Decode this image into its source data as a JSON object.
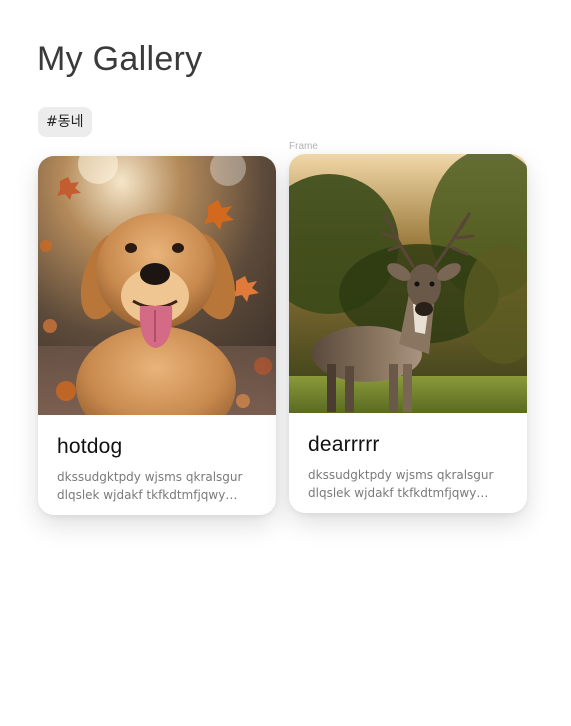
{
  "page": {
    "title": "My Gallery"
  },
  "tags": [
    {
      "label": "#동네"
    }
  ],
  "frame_label": "Frame",
  "cards": [
    {
      "title": "hotdog",
      "description": "dkssudgktpdy wjsms qkralsgur dlqslek wjdakf tkfkdtmfjqwy…",
      "image_icon": "golden-retriever-photo"
    },
    {
      "title": "dearrrrr",
      "description": "dkssudgktpdy wjsms qkralsgur dlqslek wjdakf tkfkdtmfjqwy…",
      "image_icon": "deer-photo"
    }
  ],
  "colors": {
    "background": "#ffffff",
    "title": "#3a3a3a",
    "chip_bg": "#ececec",
    "card_title": "#111111",
    "card_desc": "#7a7a7a"
  }
}
